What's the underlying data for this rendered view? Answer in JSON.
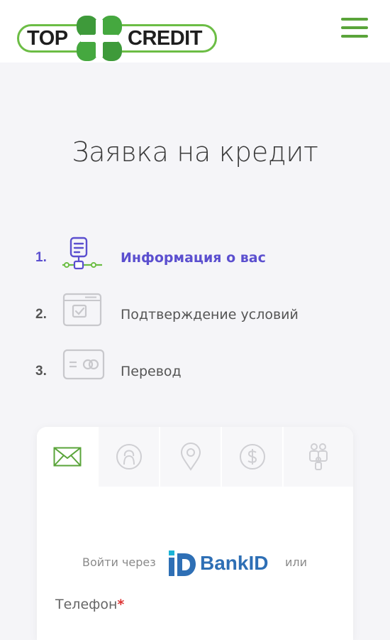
{
  "header": {
    "logo_left": "TOP",
    "logo_right": "CREDIT",
    "menu_icon": "hamburger-menu-icon"
  },
  "page": {
    "title": "Заявка на кредит"
  },
  "steps": [
    {
      "number": "1.",
      "label": "Информация о вас",
      "icon": "form-document-icon",
      "active": true
    },
    {
      "number": "2.",
      "label": "Подтверждение условий",
      "icon": "browser-checkbox-icon",
      "active": false
    },
    {
      "number": "3.",
      "label": "Перевод",
      "icon": "card-transfer-icon",
      "active": false
    }
  ],
  "form_tabs": [
    {
      "icon": "envelope-icon",
      "active": true
    },
    {
      "icon": "user-avatar-icon",
      "active": false
    },
    {
      "icon": "location-pin-icon",
      "active": false
    },
    {
      "icon": "dollar-coin-icon",
      "active": false
    },
    {
      "icon": "family-icon",
      "active": false
    }
  ],
  "login": {
    "prefix": "Войти через",
    "bankid_text": "BankID",
    "suffix": "или"
  },
  "phone_field": {
    "label": "Телефон",
    "required_mark": "*"
  },
  "colors": {
    "brand_green": "#6cbd45",
    "menu_green": "#5aa43a",
    "active_step": "#5b4fcf",
    "bankid_blue": "#2e6fb5",
    "background": "#f5f5f8"
  }
}
